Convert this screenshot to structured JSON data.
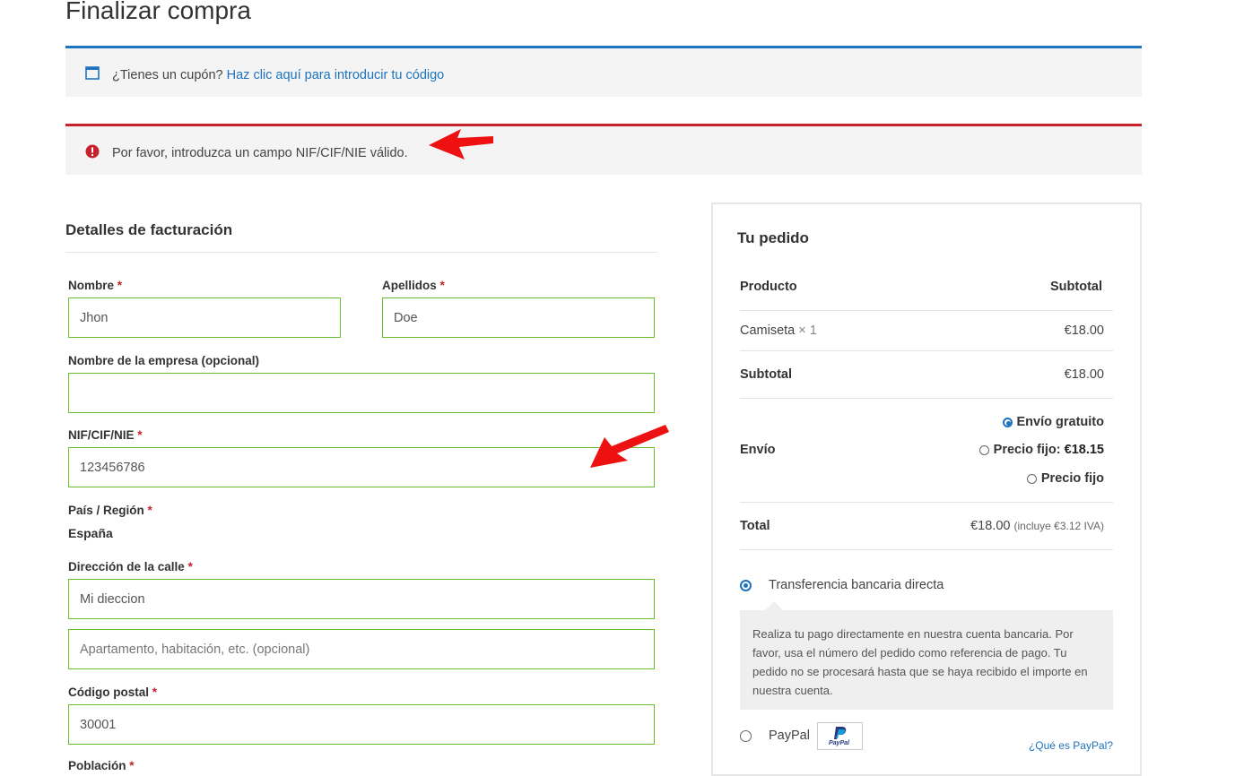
{
  "page": {
    "title": "Finalizar compra"
  },
  "coupon": {
    "text": "¿Tienes un cupón?",
    "link": "Haz clic aquí para introducir tu código"
  },
  "error": {
    "text": "Por favor, introduzca un campo NIF/CIF/NIE válido."
  },
  "billing": {
    "heading": "Detalles de facturación",
    "required_mark": "*",
    "first_name": {
      "label": "Nombre",
      "value": "Jhon"
    },
    "last_name": {
      "label": "Apellidos",
      "value": "Doe"
    },
    "company": {
      "label": "Nombre de la empresa (opcional)",
      "value": ""
    },
    "nif": {
      "label": "NIF/CIF/NIE",
      "value": "123456786"
    },
    "country": {
      "label": "País / Región",
      "value": "España"
    },
    "street": {
      "label": "Dirección de la calle",
      "value": "Mi dieccion",
      "placeholder2": "Apartamento, habitación, etc. (opcional)"
    },
    "postcode": {
      "label": "Código postal",
      "value": "30001"
    },
    "city": {
      "label": "Población"
    }
  },
  "order": {
    "heading": "Tu pedido",
    "col_product": "Producto",
    "col_subtotal": "Subtotal",
    "item": {
      "name": "Camiseta",
      "qty": "× 1",
      "price": "€18.00"
    },
    "subtotal": {
      "label": "Subtotal",
      "value": "€18.00"
    },
    "shipping": {
      "label": "Envío",
      "options": [
        {
          "label": "Envío gratuito",
          "selected": true
        },
        {
          "label": "Precio fijo:",
          "price": "€18.15",
          "selected": false
        },
        {
          "label": "Precio fijo",
          "selected": false
        }
      ]
    },
    "total": {
      "label": "Total",
      "value": "€18.00",
      "tax": "(incluye €3.12 IVA)"
    },
    "payment": {
      "bank": {
        "label": "Transferencia bancaria directa",
        "selected": true,
        "description": "Realiza tu pago directamente en nuestra cuenta bancaria. Por favor, usa el número del pedido como referencia de pago. Tu pedido no se procesará hasta que se haya recibido el importe en nuestra cuenta."
      },
      "paypal": {
        "label": "PayPal",
        "logo_text": "PayPal",
        "what_link": "¿Qué es PayPal?",
        "selected": false
      }
    }
  },
  "colors": {
    "accent": "#1e73be",
    "error": "#c5222b",
    "valid": "#69bf29",
    "arrow": "#ee1111"
  }
}
